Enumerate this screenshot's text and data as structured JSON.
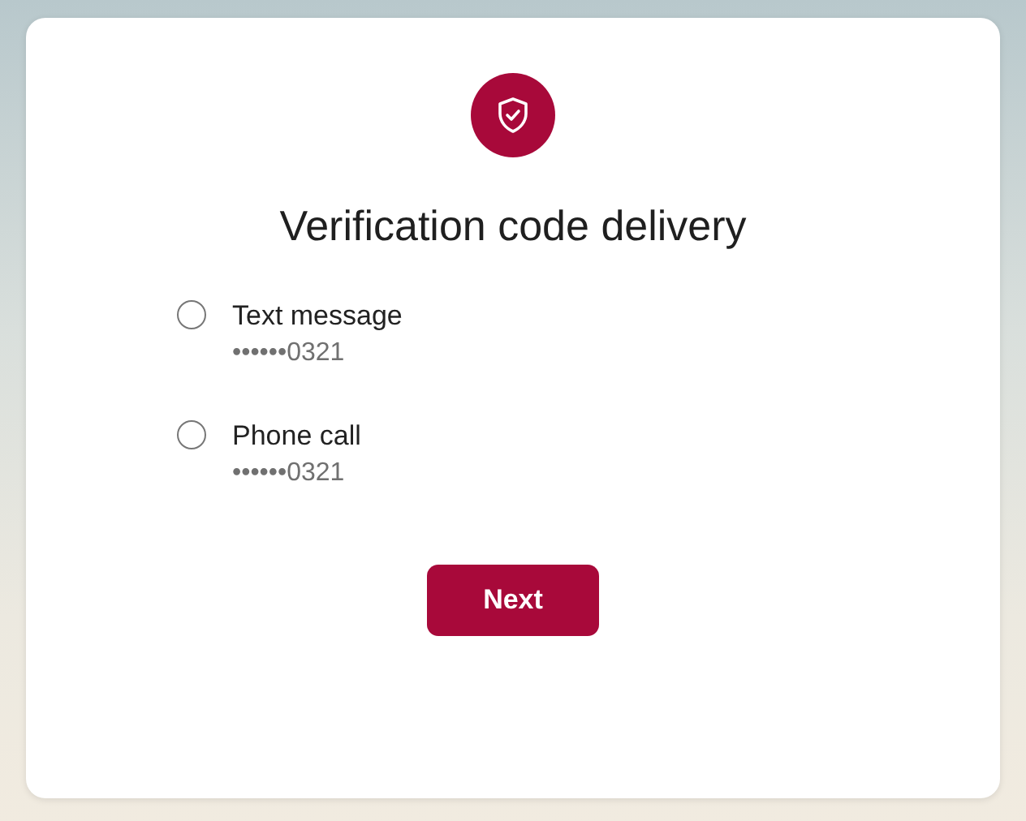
{
  "title": "Verification code delivery",
  "options": [
    {
      "label": "Text message",
      "detail": "••••••0321",
      "selected": false
    },
    {
      "label": "Phone call",
      "detail": "••••••0321",
      "selected": false
    }
  ],
  "button": "Next"
}
